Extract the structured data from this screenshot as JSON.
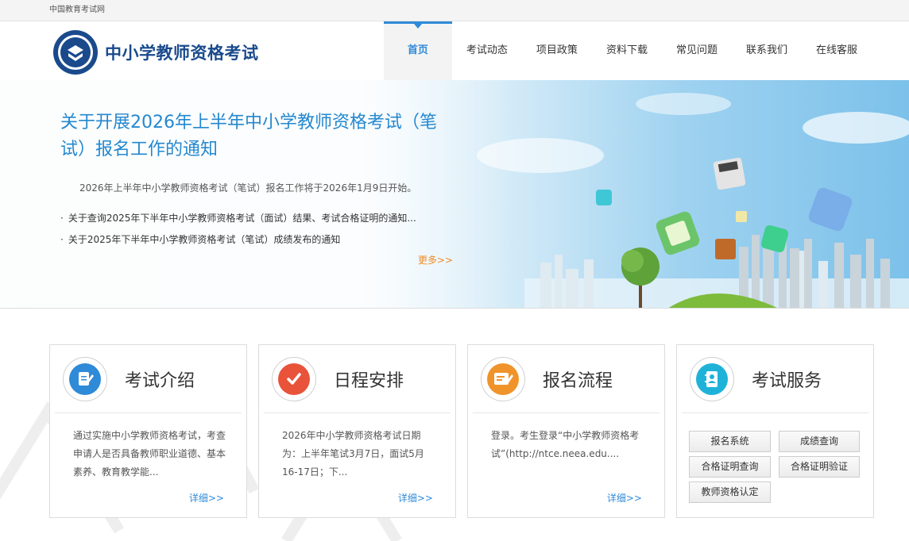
{
  "topbar": {
    "site_name": "中国教育考试网"
  },
  "header": {
    "title": "中小学教师资格考试",
    "nav": [
      {
        "label": "首页",
        "active": true
      },
      {
        "label": "考试动态"
      },
      {
        "label": "项目政策"
      },
      {
        "label": "资料下载"
      },
      {
        "label": "常见问题"
      },
      {
        "label": "联系我们"
      },
      {
        "label": "在线客服"
      }
    ]
  },
  "banner": {
    "headline": "关于开展2026年上半年中小学教师资格考试（笔试）报名工作的通知",
    "summary": "2026年上半年中小学教师资格考试（笔试）报名工作将于2026年1月9日开始。",
    "news": [
      "关于查询2025年下半年中小学教师资格考试（面试）结果、考试合格证明的通知...",
      "关于2025年下半年中小学教师资格考试（笔试）成绩发布的通知"
    ],
    "more": "更多>>"
  },
  "cards": [
    {
      "title": "考试介绍",
      "icon": "document-pen-icon",
      "text": "通过实施中小学教师资格考试，考查申请人是否具备教师职业道德、基本素养、教育教学能...",
      "detail": "详细>>"
    },
    {
      "title": "日程安排",
      "icon": "checkmark-icon",
      "text": "2026年中小学教师资格考试日期为：上半年笔试3月7日，面试5月16-17日；下...",
      "detail": "详细>>"
    },
    {
      "title": "报名流程",
      "icon": "registration-form-icon",
      "text": "登录。考生登录“中小学教师资格考试”(http://ntce.neea.edu....",
      "detail": "详细>>"
    },
    {
      "title": "考试服务",
      "icon": "contact-book-icon",
      "buttons": [
        "报名系统",
        "成绩查询",
        "合格证明查询",
        "合格证明验证",
        "教师资格认定"
      ]
    }
  ],
  "colors": {
    "brand": "#1a4a8c",
    "accent": "#2f8ad8",
    "more": "#f08a24"
  }
}
